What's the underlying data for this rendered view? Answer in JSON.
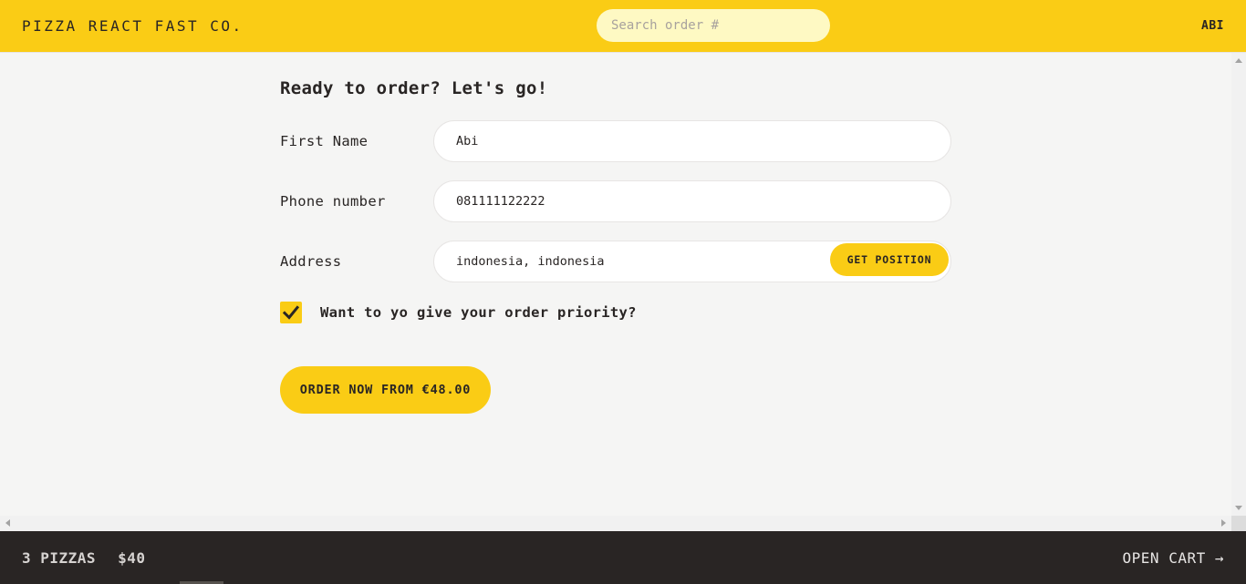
{
  "header": {
    "logo": "Pizza React Fast Co.",
    "search_placeholder": "Search order #",
    "username": "ABI"
  },
  "form": {
    "title": "Ready to order? Let's go!",
    "first_name": {
      "label": "First Name",
      "value": "Abi"
    },
    "phone": {
      "label": "Phone number",
      "value": "081111122222"
    },
    "address": {
      "label": "Address",
      "value": "indonesia, indonesia",
      "button": "Get position"
    },
    "priority": {
      "label": "Want to yo give your order priority?",
      "checked": true
    },
    "submit": "Order now from €48.00"
  },
  "footer": {
    "pizza_count": "3 pizzas",
    "total": "$40",
    "open_cart": "Open cart →"
  },
  "colors": {
    "accent": "#facc15",
    "dark": "#292524",
    "background": "#f5f5f4"
  }
}
